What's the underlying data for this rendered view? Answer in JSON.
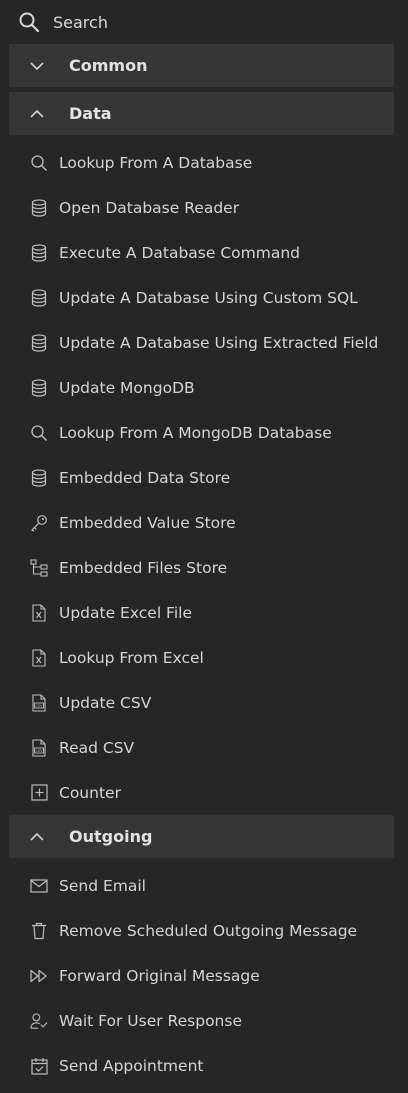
{
  "search": {
    "label": "Search",
    "icon": "search-icon"
  },
  "sections": {
    "common": {
      "label": "Common",
      "expanded": false
    },
    "data": {
      "label": "Data",
      "expanded": true,
      "items": [
        {
          "label": "Lookup From A Database",
          "icon": "search-icon"
        },
        {
          "label": "Open Database Reader",
          "icon": "database-icon"
        },
        {
          "label": "Execute A Database Command",
          "icon": "database-icon"
        },
        {
          "label": "Update A Database Using Custom SQL",
          "icon": "database-icon"
        },
        {
          "label": "Update A Database Using Extracted Field",
          "icon": "database-icon"
        },
        {
          "label": "Update MongoDB",
          "icon": "database-icon"
        },
        {
          "label": "Lookup From A MongoDB Database",
          "icon": "search-icon"
        },
        {
          "label": "Embedded Data Store",
          "icon": "database-icon"
        },
        {
          "label": "Embedded Value Store",
          "icon": "key-icon"
        },
        {
          "label": "Embedded Files Store",
          "icon": "folder-tree-icon"
        },
        {
          "label": "Update Excel File",
          "icon": "excel-file-icon"
        },
        {
          "label": "Lookup From Excel",
          "icon": "excel-file-icon"
        },
        {
          "label": "Update CSV",
          "icon": "csv-file-icon"
        },
        {
          "label": "Read CSV",
          "icon": "csv-file-icon"
        },
        {
          "label": "Counter",
          "icon": "plus-box-icon"
        }
      ]
    },
    "outgoing": {
      "label": "Outgoing",
      "expanded": true,
      "items": [
        {
          "label": "Send Email",
          "icon": "mail-icon"
        },
        {
          "label": "Remove Scheduled Outgoing Message",
          "icon": "trash-icon"
        },
        {
          "label": "Forward Original Message",
          "icon": "forward-icon"
        },
        {
          "label": "Wait For User Response",
          "icon": "user-check-icon"
        },
        {
          "label": "Send Appointment",
          "icon": "calendar-check-icon"
        }
      ]
    }
  }
}
